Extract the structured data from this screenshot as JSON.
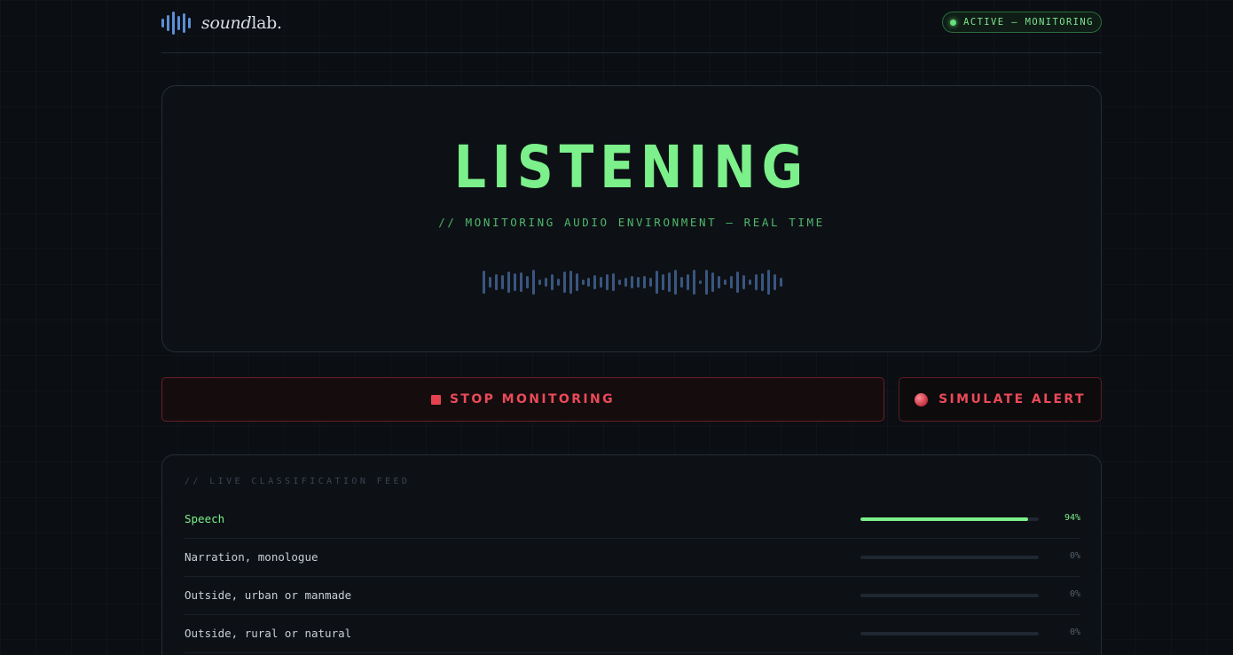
{
  "header": {
    "logo_text_italic": "sound",
    "logo_text_regular": "lab.",
    "logo_icon": "waveform-icon",
    "status_label": "ACTIVE — MONITORING"
  },
  "hero": {
    "title": "LISTENING",
    "subtitle": "// MONITORING AUDIO ENVIRONMENT — REAL TIME",
    "waveform_icon": "waveform-icon"
  },
  "actions": {
    "stop_label": "STOP MONITORING",
    "alert_label": "SIMULATE ALERT"
  },
  "feed": {
    "title": "// LIVE CLASSIFICATION FEED",
    "rows": [
      {
        "label": "Speech",
        "value": 0.94,
        "pct": "94%",
        "active": true
      },
      {
        "label": "Narration, monologue",
        "value": 0.0,
        "pct": "0%",
        "active": false
      },
      {
        "label": "Outside, urban or manmade",
        "value": 0.0,
        "pct": "0%",
        "active": false
      },
      {
        "label": "Outside, rural or natural",
        "value": 0.0,
        "pct": "0%",
        "active": false
      }
    ]
  },
  "colors": {
    "accent_green": "#7cf08a",
    "alert_red": "#ea4a58",
    "waveform_blue": "#3a5680",
    "logo_blue": "#5b8fd6"
  }
}
